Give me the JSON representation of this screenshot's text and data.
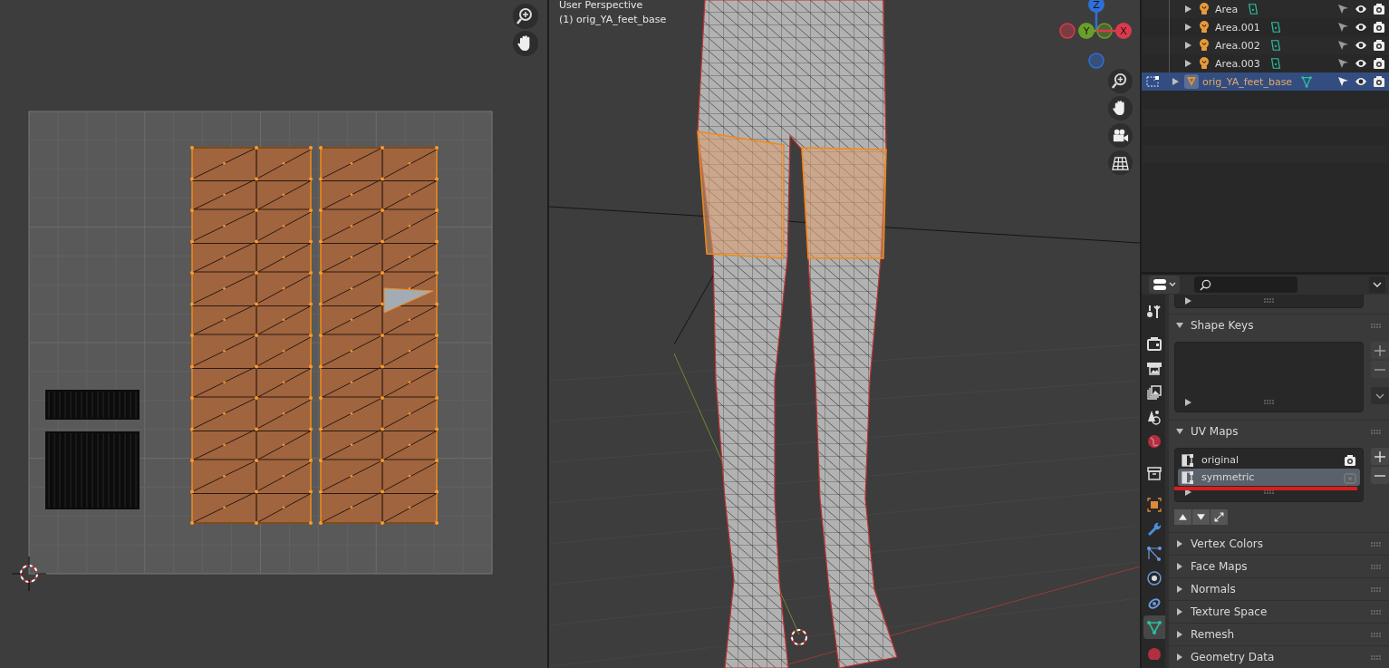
{
  "viewport": {
    "view_name": "User Perspective",
    "object_label": "(1) orig_YA_feet_base",
    "axes": [
      {
        "label": "Z",
        "color": "#2e6fd8"
      },
      {
        "label": "Y",
        "color": "#6a9f2a"
      },
      {
        "label": "X",
        "color": "#dc3a4c"
      }
    ]
  },
  "outliner": {
    "items": [
      {
        "name": "Area",
        "kind": "light",
        "selected": false
      },
      {
        "name": "Area.001",
        "kind": "light",
        "selected": false
      },
      {
        "name": "Area.002",
        "kind": "light",
        "selected": false
      },
      {
        "name": "Area.003",
        "kind": "light",
        "selected": false
      },
      {
        "name": "orig_YA_feet_base",
        "kind": "mesh",
        "selected": true
      }
    ]
  },
  "properties": {
    "tabs": [
      {
        "kind": "tool",
        "selected": false
      },
      {
        "kind": "render",
        "selected": false
      },
      {
        "kind": "output",
        "selected": false
      },
      {
        "kind": "view_layer",
        "selected": false
      },
      {
        "kind": "scene",
        "selected": false
      },
      {
        "kind": "world",
        "selected": false
      },
      {
        "kind": "collection",
        "selected": false
      },
      {
        "kind": "object",
        "selected": false
      },
      {
        "kind": "modifier",
        "selected": false
      },
      {
        "kind": "particles",
        "selected": false
      },
      {
        "kind": "physics",
        "selected": false
      },
      {
        "kind": "constraints",
        "selected": false
      },
      {
        "kind": "data",
        "selected": true
      },
      {
        "kind": "material",
        "selected": false
      }
    ],
    "panels": [
      {
        "title": "Shape Keys",
        "kind": "list",
        "expanded": true
      },
      {
        "title": "UV Maps",
        "kind": "uv_list",
        "expanded": true,
        "items": [
          {
            "name": "original",
            "selected": false
          },
          {
            "name": "symmetric",
            "selected": true
          }
        ]
      },
      {
        "title": "Vertex Colors",
        "expanded": false
      },
      {
        "title": "Face Maps",
        "expanded": false
      },
      {
        "title": "Normals",
        "expanded": false
      },
      {
        "title": "Texture Space",
        "expanded": false
      },
      {
        "title": "Remesh",
        "expanded": false
      },
      {
        "title": "Geometry Data",
        "expanded": false
      }
    ]
  }
}
